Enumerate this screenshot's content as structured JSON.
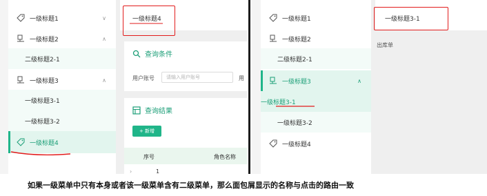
{
  "left": {
    "menu": [
      {
        "label": "一级标题1",
        "icon": "tag-icon",
        "chevron": "∨"
      },
      {
        "label": "一级标题2",
        "icon": "monitor-icon",
        "chevron": "∧"
      },
      {
        "label": "二级标题2-1"
      },
      {
        "label": "一级标题3",
        "icon": "monitor-icon",
        "chevron": "∧"
      },
      {
        "label": "一级标题3-1"
      },
      {
        "label": "一级标题3-2"
      },
      {
        "label": "一级标题4",
        "icon": "tag-icon"
      }
    ],
    "breadcrumb": "一级标题4",
    "query": {
      "title": "查询条件",
      "field_label": "用户账号",
      "placeholder": "请输入用户账号",
      "cut_label": "用"
    },
    "results": {
      "title": "查询结果",
      "add_button": "+ 新增",
      "col_index": "序号",
      "col_role": "角色名称",
      "row_index": "1",
      "expand": "›"
    }
  },
  "right": {
    "menu": [
      {
        "label": "一级标题1",
        "icon": "tag-icon"
      },
      {
        "label": "一级标题2",
        "icon": "monitor-icon"
      },
      {
        "label": "二级标题2-1"
      },
      {
        "label": "一级标题3",
        "icon": "monitor-icon",
        "chevron": "∧"
      },
      {
        "label": "一级标题3-1"
      },
      {
        "label": "一级标题3-2"
      },
      {
        "label": "一级标题4",
        "icon": "tag-icon"
      }
    ],
    "breadcrumb": "一级标题3-1",
    "page_text": "出库单"
  },
  "caption": "如果一级菜单中只有本身或者该一级菜单含有二级菜单，那么面包屑显示的名称与点击的路由一致",
  "colors": {
    "accent": "#1b9e77",
    "accent_bg": "#e2f5ee",
    "annotation_red": "#e21b1b"
  }
}
